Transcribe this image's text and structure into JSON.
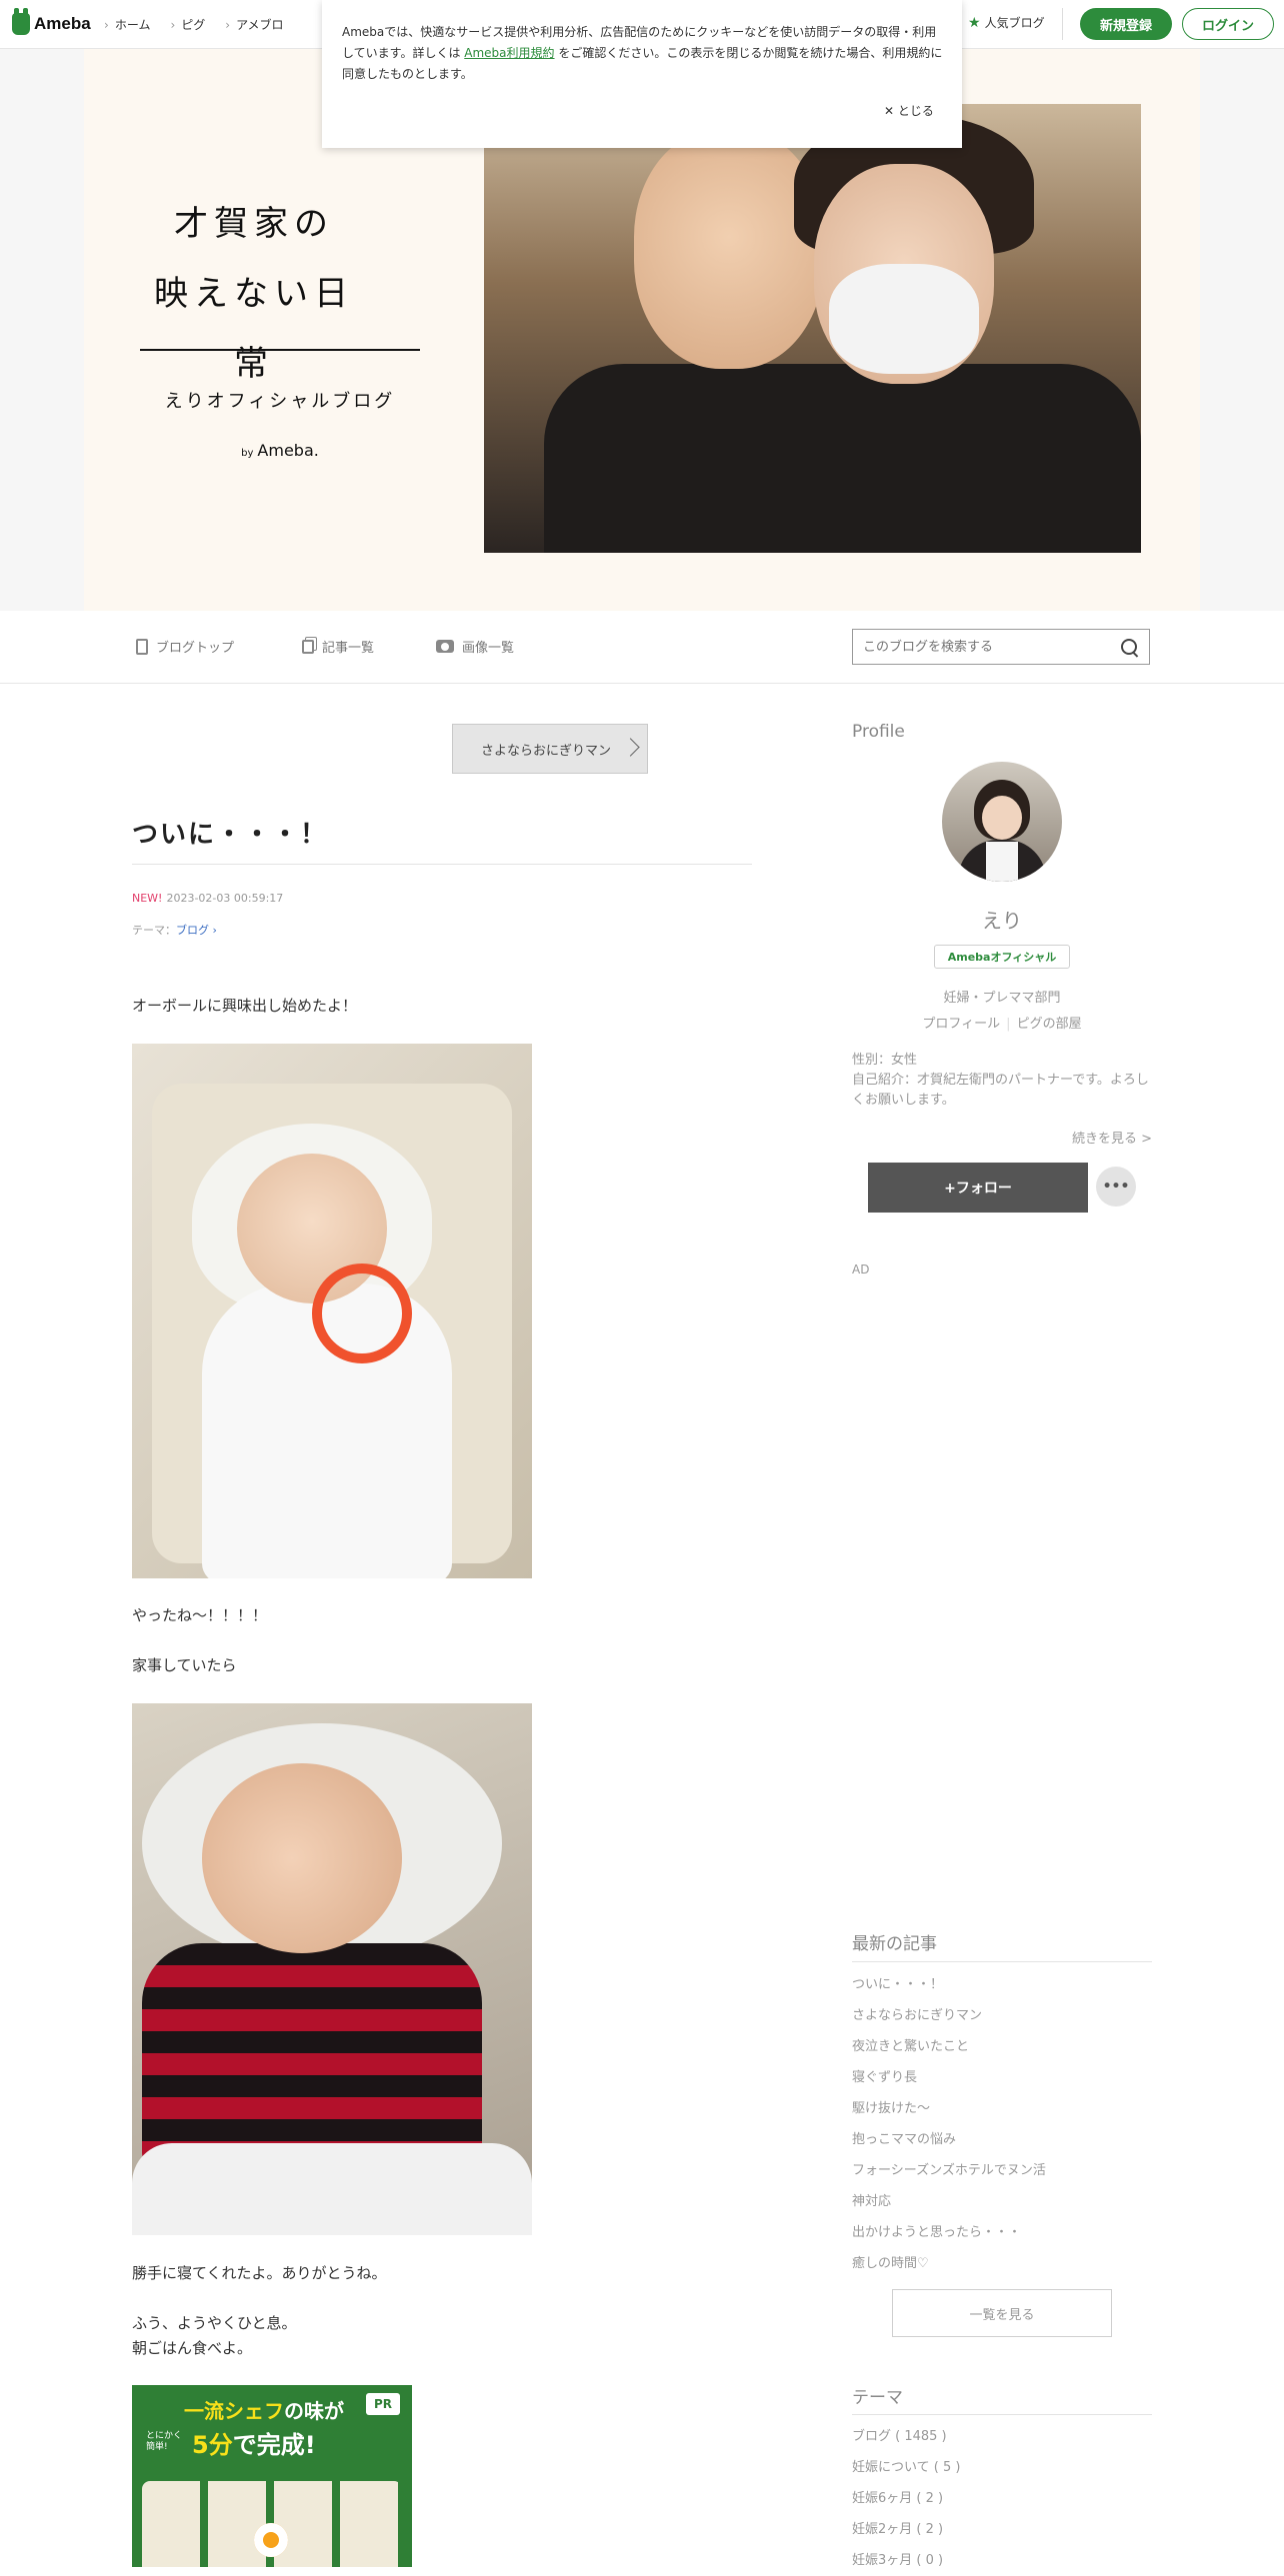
{
  "topnav": {
    "brand": "Ameba",
    "links": [
      "ホーム",
      "ピグ",
      "アメブロ"
    ],
    "popular": "人気ブログ",
    "register": "新規登録",
    "login": "ログイン"
  },
  "cookie": {
    "text_before": "Amebaでは、快適なサービス提供や利用分析、広告配信のためにクッキーなどを使い訪問データの取得・利用しています。詳しくは ",
    "link": "Ameba利用規約",
    "text_after": " をご確認ください。この表示を閉じるか閲覧を続けた場合、利用規約に同意したものとします。",
    "close": "✕ とじる"
  },
  "header": {
    "title_line1": "才賀家の",
    "title_line2": "映えない日常",
    "subtitle": "えりオフィシャルブログ",
    "by": "by",
    "by_brand": "Ameba."
  },
  "blognav": {
    "top": "ブログトップ",
    "entries": "記事一覧",
    "images": "画像一覧",
    "search_placeholder": "このブログを検索する"
  },
  "article": {
    "prev_label": "さよならおにぎりマン",
    "title": "ついに・・・！",
    "new_badge": "NEW!",
    "date": "2023-02-03 00:59:17",
    "theme_prefix": "テーマ：",
    "theme": "ブログ ›",
    "p1": "オーボールに興味出し始めたよ！",
    "p2": "やったね〜！！！！",
    "p3": "家事していたら",
    "p4": "勝手に寝てくれたよ。ありがとうね。",
    "p5": "ふう、ようやくひと息。",
    "p6": "朝ごはん食べよ。"
  },
  "ad_banner": {
    "line1_a": "一流シェフ",
    "line1_b": "の味が",
    "line0": "とにかく簡単!",
    "line2_a": "5分",
    "line2_b": "で完成!",
    "pr": "PR"
  },
  "profile": {
    "heading": "Profile",
    "name": "えり",
    "badge": "Amebaオフィシャル",
    "category": "妊婦・プレママ部門",
    "link_profile": "プロフィール",
    "link_room": "ピグの部屋",
    "gender": "性別：女性",
    "intro": "自己紹介：才賀紀左衛門のパートナーです。よろしくお願いします。",
    "more": "続きを見る >",
    "follow": "+フォロー",
    "dots": "•••"
  },
  "ad_label": "AD",
  "recent": {
    "heading": "最新の記事",
    "items": [
      "ついに・・・！",
      "さよならおにぎりマン",
      "夜泣きと驚いたこと",
      "寝ぐずり長",
      "駆け抜けた〜",
      "抱っこママの悩み",
      "フォーシーズンズホテルでヌン活",
      "神対応",
      "出かけようと思ったら・・・",
      "癒しの時間♡"
    ],
    "view_all": "一覧を見る"
  },
  "themes": {
    "heading": "テーマ",
    "items": [
      "ブログ ( 1485 )",
      "妊娠について ( 5 )",
      "妊娠6ヶ月 ( 2 )",
      "妊娠2ヶ月 ( 2 )",
      "妊娠3ヶ月 ( 0 )"
    ]
  }
}
